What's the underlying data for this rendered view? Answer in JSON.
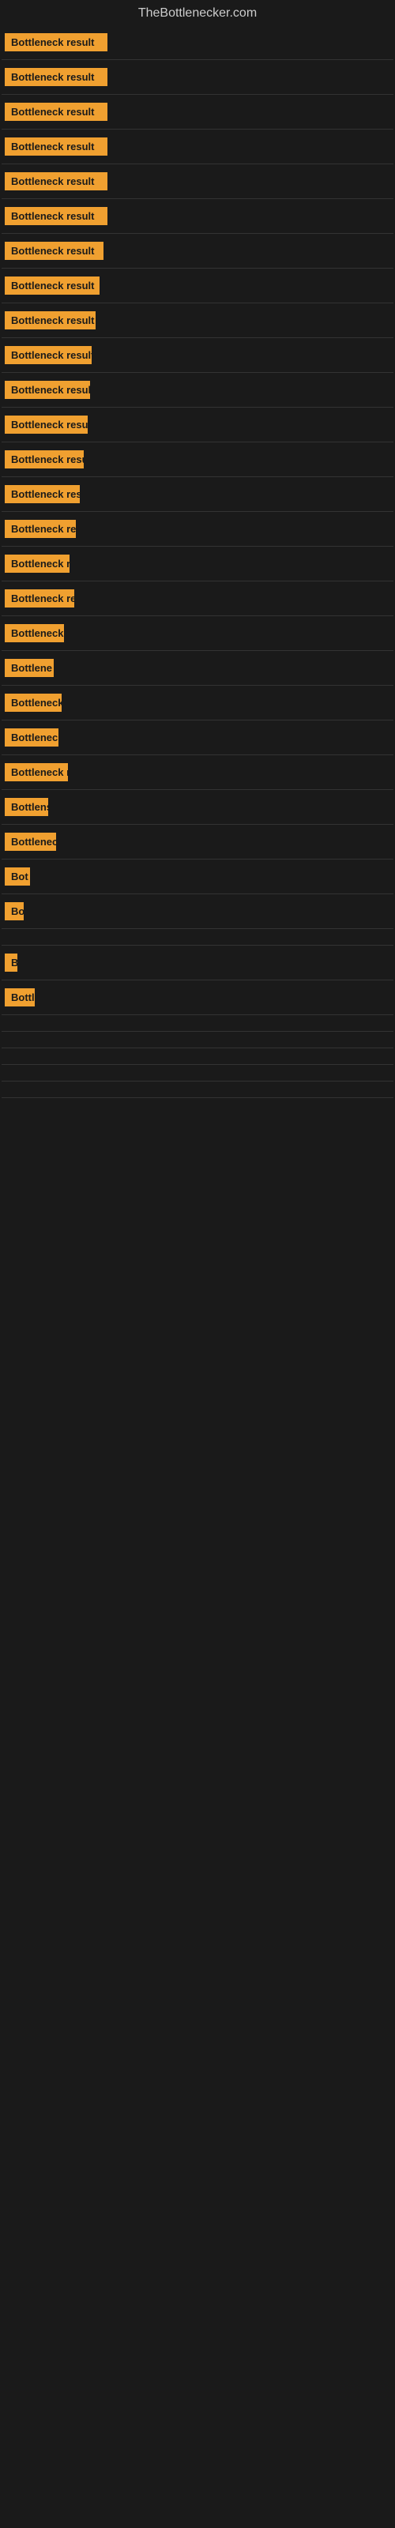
{
  "site": {
    "title": "TheBottlenecker.com"
  },
  "items": [
    {
      "id": 1,
      "label": "Bottleneck result",
      "width": 130
    },
    {
      "id": 2,
      "label": "Bottleneck result",
      "width": 130
    },
    {
      "id": 3,
      "label": "Bottleneck result",
      "width": 130
    },
    {
      "id": 4,
      "label": "Bottleneck result",
      "width": 130
    },
    {
      "id": 5,
      "label": "Bottleneck result",
      "width": 130
    },
    {
      "id": 6,
      "label": "Bottleneck result",
      "width": 130
    },
    {
      "id": 7,
      "label": "Bottleneck result",
      "width": 125
    },
    {
      "id": 8,
      "label": "Bottleneck result",
      "width": 120
    },
    {
      "id": 9,
      "label": "Bottleneck result",
      "width": 115
    },
    {
      "id": 10,
      "label": "Bottleneck result",
      "width": 110
    },
    {
      "id": 11,
      "label": "Bottleneck result",
      "width": 108
    },
    {
      "id": 12,
      "label": "Bottleneck result",
      "width": 105
    },
    {
      "id": 13,
      "label": "Bottleneck result",
      "width": 100
    },
    {
      "id": 14,
      "label": "Bottleneck result",
      "width": 95
    },
    {
      "id": 15,
      "label": "Bottleneck result",
      "width": 90
    },
    {
      "id": 16,
      "label": "Bottleneck re",
      "width": 82
    },
    {
      "id": 17,
      "label": "Bottleneck result",
      "width": 88
    },
    {
      "id": 18,
      "label": "Bottleneck r",
      "width": 75
    },
    {
      "id": 19,
      "label": "Bottlene",
      "width": 62
    },
    {
      "id": 20,
      "label": "Bottleneck r",
      "width": 72
    },
    {
      "id": 21,
      "label": "Bottleneck",
      "width": 68
    },
    {
      "id": 22,
      "label": "Bottleneck res",
      "width": 80
    },
    {
      "id": 23,
      "label": "Bottlens",
      "width": 55
    },
    {
      "id": 24,
      "label": "Bottleneck",
      "width": 65
    },
    {
      "id": 25,
      "label": "Bot",
      "width": 32
    },
    {
      "id": 26,
      "label": "Bo",
      "width": 24
    },
    {
      "id": 27,
      "label": "",
      "width": 0
    },
    {
      "id": 28,
      "label": "B",
      "width": 14
    },
    {
      "id": 29,
      "label": "Bottl",
      "width": 38
    },
    {
      "id": 30,
      "label": "",
      "width": 0
    },
    {
      "id": 31,
      "label": "",
      "width": 0
    },
    {
      "id": 32,
      "label": "",
      "width": 0
    },
    {
      "id": 33,
      "label": "",
      "width": 0
    },
    {
      "id": 34,
      "label": "",
      "width": 0
    }
  ]
}
